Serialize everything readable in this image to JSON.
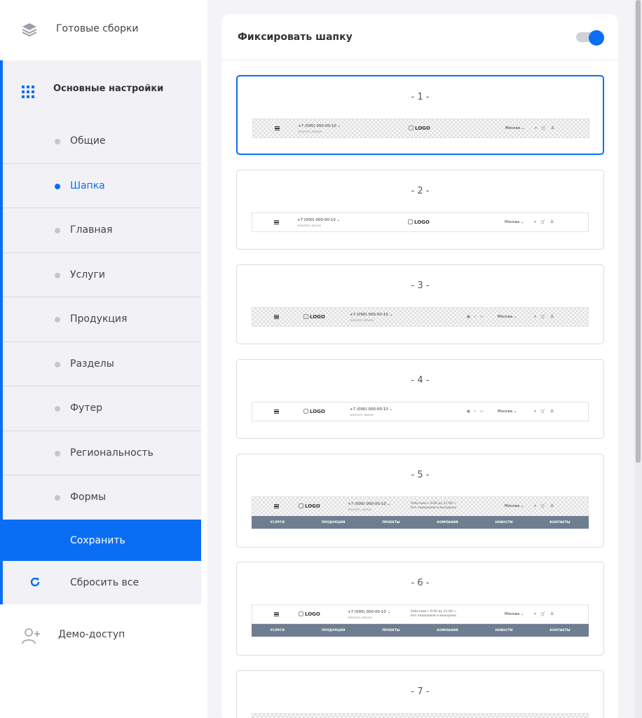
{
  "sidebar": {
    "top_label": "Готовые сборки",
    "main_label": "Основные настройки",
    "items": [
      {
        "label": "Общие"
      },
      {
        "label": "Шапка"
      },
      {
        "label": "Главная"
      },
      {
        "label": "Услуги"
      },
      {
        "label": "Продукция"
      },
      {
        "label": "Разделы"
      },
      {
        "label": "Футер"
      },
      {
        "label": "Региональность"
      },
      {
        "label": "Формы"
      }
    ],
    "active_item": "Шапка",
    "save_label": "Сохранить",
    "reset_label": "Сбросить все",
    "demo_label": "Демо-доступ"
  },
  "panel": {
    "title": "Фиксировать шапку",
    "toggle_on": true
  },
  "header_preview": {
    "phone": "+7 (000) 000-00-10 ⌄",
    "phone_sub": "заказать звонок",
    "logo": "LOGO",
    "city": "Москва ⌄",
    "hours_line1": "Работаем с 9:00 до 21:00 ч",
    "hours_line2": "Без перерывов и выходных",
    "nav": [
      "УСЛУГИ",
      "ПРОДУКЦИЯ",
      "ПРОЕКТЫ",
      "КОМПАНИЯ",
      "НОВОСТИ",
      "КОНТАКТЫ"
    ]
  },
  "cards": [
    {
      "label": "- 1 -"
    },
    {
      "label": "- 2 -"
    },
    {
      "label": "- 3 -"
    },
    {
      "label": "- 4 -"
    },
    {
      "label": "- 5 -"
    },
    {
      "label": "- 6 -"
    },
    {
      "label": "- 7 -"
    }
  ],
  "colors": {
    "accent": "#0a6ef5",
    "nav_bar": "#6f7d91"
  }
}
